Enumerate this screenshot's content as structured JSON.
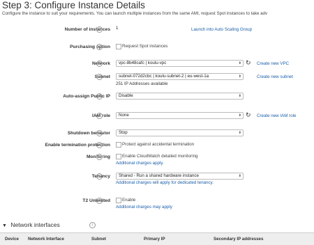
{
  "header": {
    "title": "Step 3: Configure Instance Details",
    "subtitle": "Configure the instance to suit your requirements. You can launch multiple instances from the same AMI, request Spot instances to take adv"
  },
  "fields": {
    "num_instances": {
      "label": "Number of instances",
      "value": "1",
      "link": "Launch into Auto Scaling Group"
    },
    "purchasing": {
      "label": "Purchasing option",
      "checkbox_label": "Request Spot instances"
    },
    "network": {
      "label": "Network",
      "value": "vpc-8b48cafc | koulu-vpc",
      "link": "Create new VPC"
    },
    "subnet": {
      "label": "Subnet",
      "value": "subnet-072d2cbc | koulu-subnet-2 | eu-west-1a",
      "note": "251 IP Addresses available",
      "link": "Create new subnet"
    },
    "public_ip": {
      "label": "Auto-assign Public IP",
      "value": "Disable"
    },
    "iam_role": {
      "label": "IAM role",
      "value": "None",
      "link": "Create new IAM role"
    },
    "shutdown": {
      "label": "Shutdown behavior",
      "value": "Stop"
    },
    "termination": {
      "label": "Enable termination protection",
      "checkbox_label": "Protect against accidental termination"
    },
    "monitoring": {
      "label": "Monitoring",
      "checkbox_label": "Enable CloudWatch detailed monitoring",
      "link": "Additional charges apply."
    },
    "tenancy": {
      "label": "Tenancy",
      "value": "Shared - Run a shared hardware instance",
      "link": "Additional charges will apply for dedicated tenancy."
    },
    "t2": {
      "label": "T2 Unlimited",
      "checkbox_label": "Enable",
      "link": "Additional charges may apply"
    }
  },
  "network_interfaces": {
    "title": "Network interfaces",
    "columns": [
      "Device",
      "Network Interface",
      "Subnet",
      "Primary IP",
      "Secondary IP addresses"
    ]
  },
  "icons": {
    "info": "info-icon",
    "refresh": "refresh-icon",
    "expand": "caret-down-icon",
    "dropdown": "updown-arrow-icon"
  }
}
